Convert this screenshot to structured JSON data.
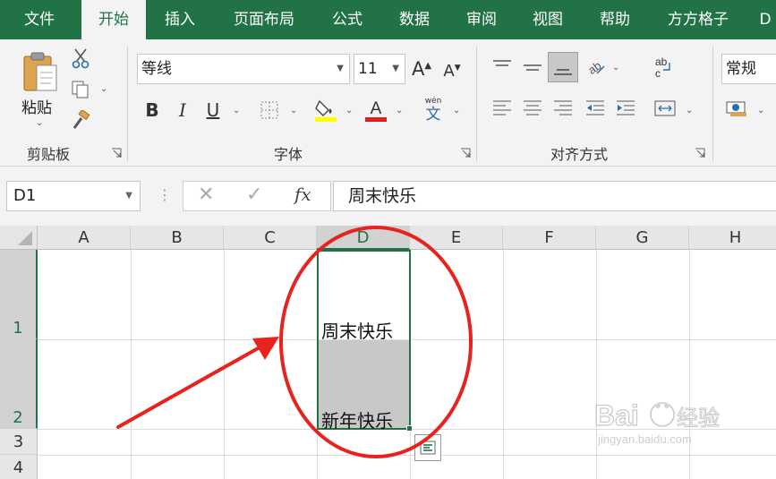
{
  "menu": {
    "tabs": [
      "文件",
      "开始",
      "插入",
      "页面布局",
      "公式",
      "数据",
      "审阅",
      "视图",
      "帮助",
      "方方格子",
      "D"
    ],
    "active_index": 1
  },
  "ribbon": {
    "clipboard": {
      "label": "剪贴板",
      "paste_label": "粘贴"
    },
    "font": {
      "label": "字体",
      "font_name": "等线",
      "font_size": "11",
      "wen_label": "wén",
      "wen_char": "文"
    },
    "alignment": {
      "label": "对齐方式"
    },
    "number": {
      "format": "常规"
    }
  },
  "formula_bar": {
    "name_box": "D1",
    "fx_label": "fx",
    "formula": "周末快乐"
  },
  "grid": {
    "columns": [
      "A",
      "B",
      "C",
      "D",
      "E",
      "F",
      "G",
      "H"
    ],
    "selected_column": "D",
    "rows": [
      "1",
      "2",
      "3",
      "4"
    ],
    "selected_rows": [
      "1",
      "2"
    ],
    "cells": {
      "D1": "周末快乐",
      "D2": "新年快乐"
    }
  },
  "colors": {
    "brand": "#217346",
    "annotation": "#e8231e",
    "selection_fill": "#c8c8c8"
  },
  "watermark": "Baidu经验 jingyan.baidu.com"
}
